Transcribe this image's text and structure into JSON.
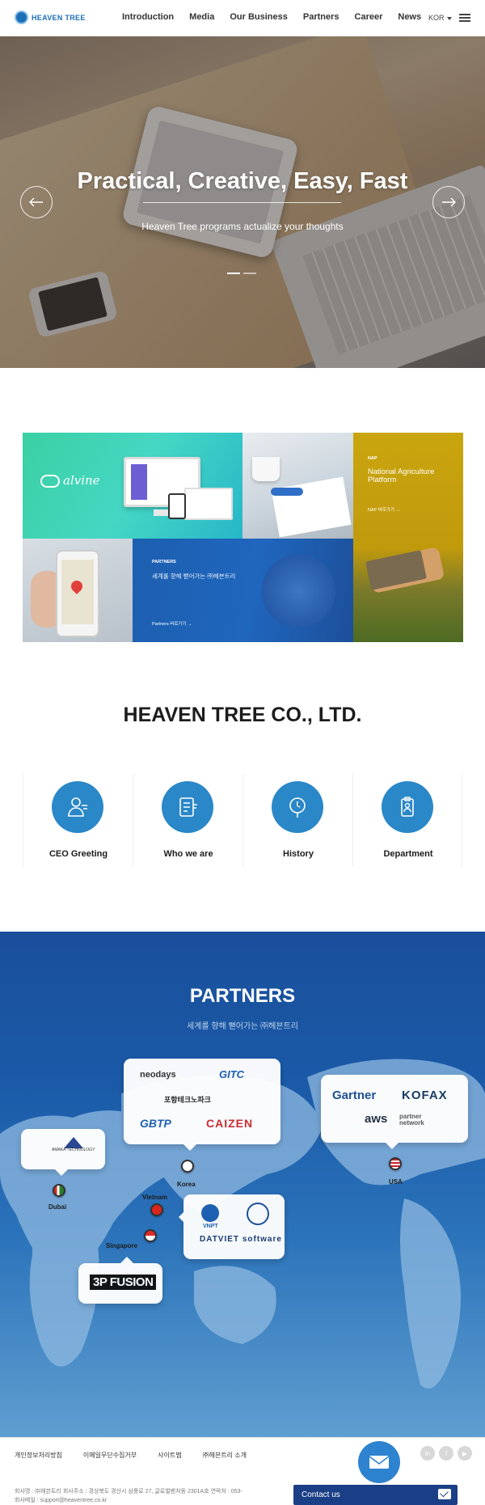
{
  "header": {
    "logo_text": "HEAVEN TREE",
    "nav": [
      "Introduction",
      "Media",
      "Our Business",
      "Partners",
      "Career",
      "News"
    ],
    "lang": "KOR"
  },
  "hero": {
    "title": "Practical, Creative, Easy, Fast",
    "subtitle": "Heaven Tree programs actualize your thoughts",
    "prev_icon": "arrow-left-icon",
    "next_icon": "arrow-right-icon",
    "slide_count": 2,
    "active_slide": 1
  },
  "tiles": {
    "alvine": {
      "brand": "alvine"
    },
    "nap": {
      "tag": "NAP",
      "title": "National Agriculture Platform",
      "link": "NAP 바로가기 →"
    },
    "partners": {
      "tag": "PARTNERS",
      "title": "세계를 향해 뻗어가는 ㈜헤븐트리",
      "link": "Partners 바로가기 →"
    }
  },
  "company": {
    "title": "HEAVEN TREE CO., LTD.",
    "cards": [
      {
        "label": "CEO Greeting",
        "icon": "person-icon"
      },
      {
        "label": "Who we are",
        "icon": "document-icon"
      },
      {
        "label": "History",
        "icon": "clock-icon"
      },
      {
        "label": "Department",
        "icon": "badge-icon"
      }
    ]
  },
  "partners": {
    "title": "PARTNERS",
    "subtitle": "세계를 향해 뻗어가는 ㈜헤븐트리",
    "locations": [
      {
        "city": "Dubai",
        "logos": [
          "AMAKA TECHNOLOGY"
        ]
      },
      {
        "city": "Korea",
        "logos": [
          "neodays",
          "GITC",
          "포항테크노파크",
          "GBTP",
          "CAIZEN"
        ]
      },
      {
        "city": "USA",
        "logos": [
          "Gartner",
          "KOFAX",
          "aws",
          "partner network"
        ]
      },
      {
        "city": "Vietnam",
        "logos": [
          "VNPT",
          "DATVIET software"
        ]
      },
      {
        "city": "Singapore",
        "logos": [
          "3P FUSION"
        ]
      }
    ]
  },
  "footer": {
    "links": [
      "개인정보처리방침",
      "이메일무단수집거부",
      "사이트맵",
      "㈜헤븐트리 소개"
    ],
    "info_line1": "회사명 : ㈜헤븐트리       회사주소 : 경상북도 경산시 삼풍로 27, 글로벌벤처동 2301A호       연락처 : 053-",
    "info_line2": "회사메일 : support@heaventree.co.kr",
    "social": [
      "in",
      "f",
      "▶"
    ],
    "contact_label": "Contact us"
  },
  "colors": {
    "brand": "#1d6fb8",
    "accent": "#2a87c8",
    "nap_yellow": "#c9a50f",
    "partners_blue": "#1a5aa8",
    "contact_navy": "#1b3f86"
  }
}
